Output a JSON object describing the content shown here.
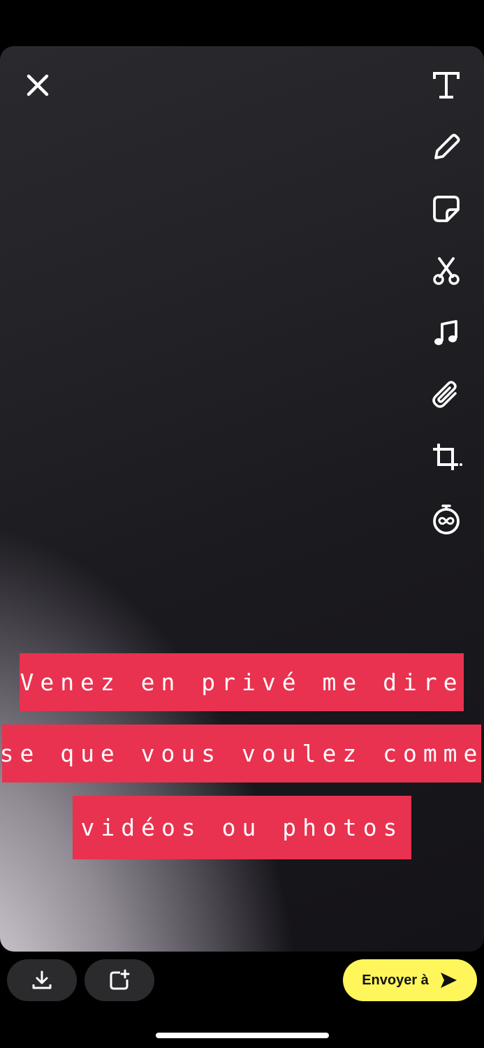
{
  "toolbar": {
    "close_icon": "close-icon",
    "tools": [
      "text-icon",
      "pencil-icon",
      "sticker-icon",
      "scissors-icon",
      "music-icon",
      "paperclip-icon",
      "crop-icon",
      "timer-infinite-icon"
    ]
  },
  "caption": {
    "lines": [
      "Venez en privé me dire",
      "se que vous voulez comme",
      "vidéos ou photos"
    ],
    "background_color": "#e8324f"
  },
  "actions": {
    "save_icon": "download-icon",
    "story_icon": "add-to-story-icon",
    "send_label": "Envoyer à",
    "send_icon": "send-arrow-icon",
    "send_color": "#fef65b"
  }
}
